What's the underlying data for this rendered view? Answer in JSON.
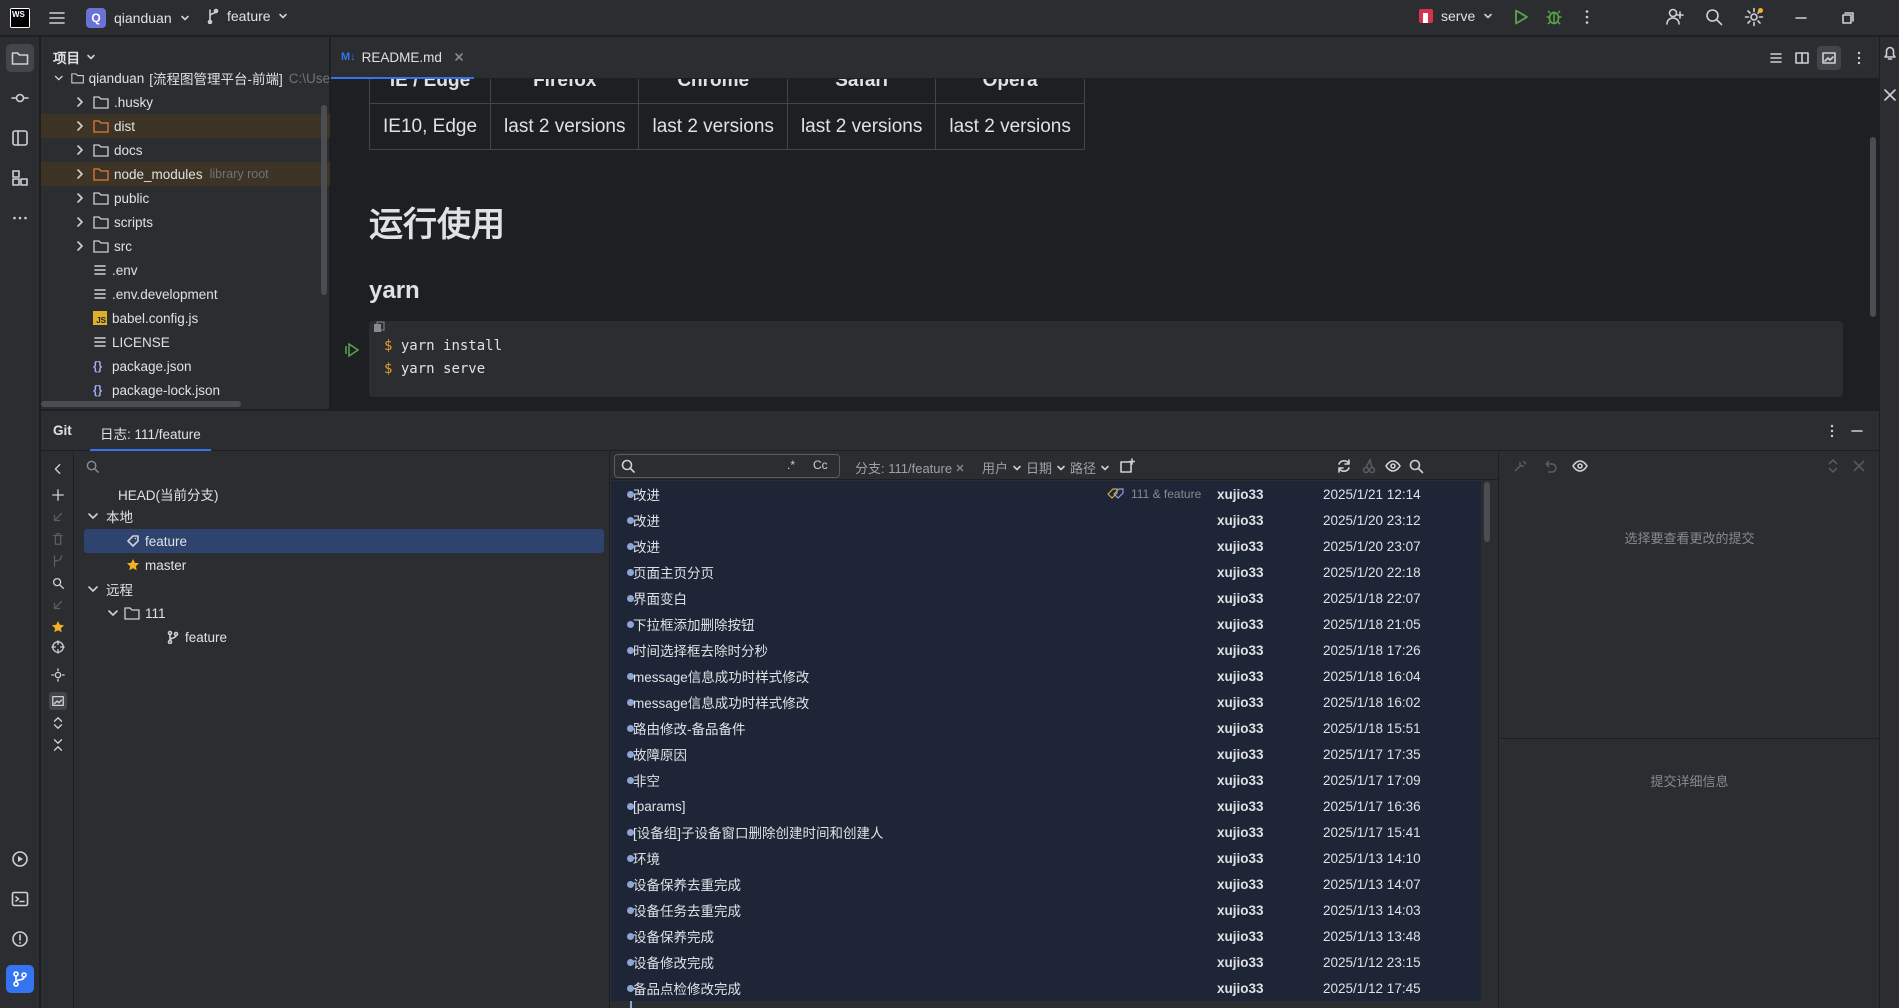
{
  "titlebar": {
    "app_logo": "WS",
    "project_initial": "Q",
    "project_name": "qianduan",
    "branch_name": "feature",
    "run_config": "serve"
  },
  "project_panel": {
    "title": "项目",
    "root": {
      "name": "qianduan",
      "desc": "[流程图管理平台-前端]",
      "path": "C:\\Use"
    },
    "items": [
      {
        "name": ".husky",
        "type": "folder"
      },
      {
        "name": "dist",
        "type": "folder-excluded"
      },
      {
        "name": "docs",
        "type": "folder"
      },
      {
        "name": "node_modules",
        "type": "folder-excluded",
        "suffix": "library root"
      },
      {
        "name": "public",
        "type": "folder"
      },
      {
        "name": "scripts",
        "type": "folder"
      },
      {
        "name": "src",
        "type": "folder"
      },
      {
        "name": ".env",
        "type": "file"
      },
      {
        "name": ".env.development",
        "type": "file"
      },
      {
        "name": "babel.config.js",
        "type": "js"
      },
      {
        "name": "LICENSE",
        "type": "file"
      },
      {
        "name": "package.json",
        "type": "json"
      },
      {
        "name": "package-lock.json",
        "type": "json"
      }
    ]
  },
  "editor": {
    "tab_icon": "M↓",
    "tab_label": "README.md",
    "table_headers": [
      "IE / Edge",
      "Firefox",
      "Chrome",
      "Safari",
      "Opera"
    ],
    "table_row": [
      "IE10, Edge",
      "last 2 versions",
      "last 2 versions",
      "last 2 versions",
      "last 2 versions"
    ],
    "heading1": "运行使用",
    "heading2": "yarn",
    "code_prompt": "$",
    "code_lines": [
      "yarn install",
      "yarn serve"
    ]
  },
  "git": {
    "tab_git": "Git",
    "tab_log": "日志: 111/feature",
    "branches": {
      "head": "HEAD(当前分支)",
      "local_label": "本地",
      "local": [
        "feature",
        "master"
      ],
      "remote_label": "远程",
      "remote_group": "111",
      "remote_branches": [
        "feature"
      ]
    },
    "filters": {
      "regex": ".*",
      "case": "Cc",
      "branch": "分支: 111/feature",
      "user": "用户",
      "date": "日期",
      "path": "路径"
    },
    "head_refs": "111 & feature",
    "commits": [
      {
        "subject": "改进",
        "author": "xujio33",
        "date": "2025/1/21 12:14"
      },
      {
        "subject": "改进",
        "author": "xujio33",
        "date": "2025/1/20 23:12"
      },
      {
        "subject": "改进",
        "author": "xujio33",
        "date": "2025/1/20 23:07"
      },
      {
        "subject": "页面主页分页",
        "author": "xujio33",
        "date": "2025/1/20 22:18"
      },
      {
        "subject": "界面变白",
        "author": "xujio33",
        "date": "2025/1/18 22:07"
      },
      {
        "subject": "下拉框添加删除按钮",
        "author": "xujio33",
        "date": "2025/1/18 21:05"
      },
      {
        "subject": "时间选择框去除时分秒",
        "author": "xujio33",
        "date": "2025/1/18 17:26"
      },
      {
        "subject": "message信息成功时样式修改",
        "author": "xujio33",
        "date": "2025/1/18 16:04"
      },
      {
        "subject": "message信息成功时样式修改",
        "author": "xujio33",
        "date": "2025/1/18 16:02"
      },
      {
        "subject": "路由修改-备品备件",
        "author": "xujio33",
        "date": "2025/1/18 15:51"
      },
      {
        "subject": "故障原因",
        "author": "xujio33",
        "date": "2025/1/17 17:35"
      },
      {
        "subject": "非空",
        "author": "xujio33",
        "date": "2025/1/17 17:09"
      },
      {
        "subject": "[params]",
        "author": "xujio33",
        "date": "2025/1/17 16:36"
      },
      {
        "subject": "[设备组]子设备窗口删除创建时间和创建人",
        "author": "xujio33",
        "date": "2025/1/17 15:41"
      },
      {
        "subject": "环境",
        "author": "xujio33",
        "date": "2025/1/13 14:10"
      },
      {
        "subject": "设备保养去重完成",
        "author": "xujio33",
        "date": "2025/1/13 14:07"
      },
      {
        "subject": "设备任务去重完成",
        "author": "xujio33",
        "date": "2025/1/13 14:03"
      },
      {
        "subject": "设备保养完成",
        "author": "xujio33",
        "date": "2025/1/13 13:48"
      },
      {
        "subject": "设备修改完成",
        "author": "xujio33",
        "date": "2025/1/12 23:15"
      },
      {
        "subject": "备品点检修改完成",
        "author": "xujio33",
        "date": "2025/1/12 17:45"
      }
    ],
    "details_empty": "选择要查看更改的提交",
    "details_info": "提交详细信息"
  },
  "colors": {
    "accent": "#3574f0",
    "selection": "#2e436e",
    "excluded_highlight": "#3d3425",
    "graph_line": "#8ea4d6"
  }
}
